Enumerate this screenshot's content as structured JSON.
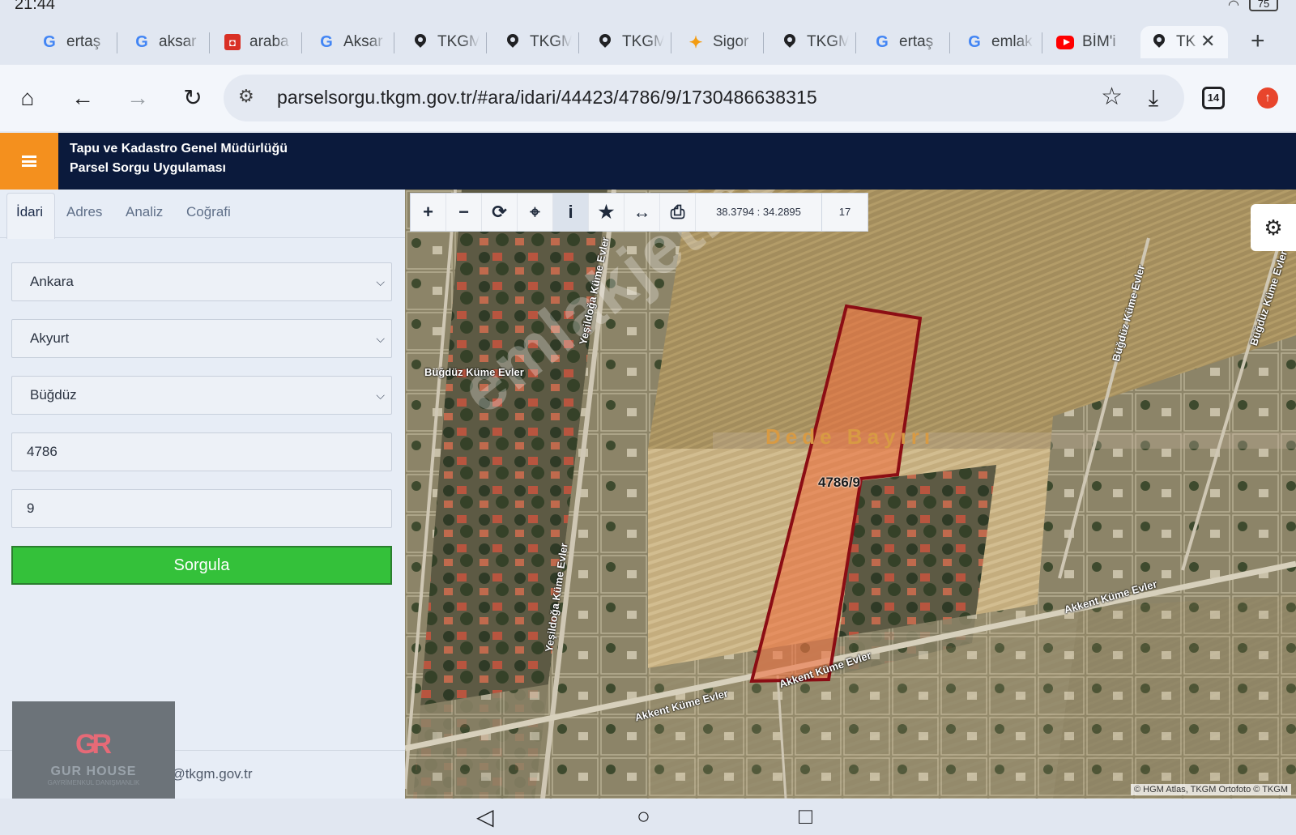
{
  "status": {
    "time": "21:44",
    "battery": "75"
  },
  "tabs": [
    {
      "icon": "google-icon",
      "label": "ertaş"
    },
    {
      "icon": "google-icon",
      "label": "aksar"
    },
    {
      "icon": "sahibinden-icon",
      "label": "araba"
    },
    {
      "icon": "google-icon",
      "label": "Aksar"
    },
    {
      "icon": "map-pin-icon",
      "label": "TKGM"
    },
    {
      "icon": "map-pin-icon",
      "label": "TKGM"
    },
    {
      "icon": "map-pin-icon",
      "label": "TKGM"
    },
    {
      "icon": "sigorta-icon",
      "label": "Sigor"
    },
    {
      "icon": "map-pin-icon",
      "label": "TKGM"
    },
    {
      "icon": "google-icon",
      "label": "ertaş"
    },
    {
      "icon": "google-icon",
      "label": "emlak"
    },
    {
      "icon": "youtube-icon",
      "label": "BİM'i"
    },
    {
      "icon": "map-pin-icon",
      "label": "TK"
    }
  ],
  "toolbar": {
    "url": "parselsorgu.tkgm.gov.tr/#ara/idari/44423/4786/9/1730486638315",
    "tab_count": "14"
  },
  "header": {
    "line1": "Tapu ve Kadastro Genel Müdürlüğü",
    "line2": "Parsel Sorgu Uygulaması"
  },
  "panel": {
    "tabs": [
      "İdari",
      "Adres",
      "Analiz",
      "Coğrafi"
    ],
    "il": "Ankara",
    "ilce": "Akyurt",
    "mahalle": "Büğdüz",
    "ada": "4786",
    "parsel": "9",
    "button": "Sorgula",
    "email": "cbs@tkgm.gov.tr"
  },
  "logo": {
    "mark": "GR",
    "name": "GUR HOUSE",
    "sub": "GAYRİMENKUL DANIŞMANLIK"
  },
  "map": {
    "coords": "38.3794 : 34.2895",
    "zoom": "17",
    "place_label": "Dede Bayırı",
    "parcel_label": "4786/9",
    "watermark": "emlakjet.com",
    "labels": {
      "bugduz1": "Büğdüz Küme Evler",
      "bugduz2": "Büğdüz Küme Evler",
      "bugduz3": "Büğdüz Küme Evler",
      "yesildoga1": "Yeşildoğa Küme Evler",
      "yesildoga2": "Yeşildoğa Küme Evler",
      "akkent1": "Akkent Küme Evler",
      "akkent2": "Akkent Küme Evler",
      "akkent3": "Akkent Küme Evler"
    },
    "attribution": "© HGM Atlas, TKGM Ortofoto © TKGM"
  },
  "colors": {
    "header": "#0b1a3c",
    "menu": "#f4901e",
    "button": "#34c13a",
    "parcel_fill": "#f26b3a",
    "parcel_stroke": "#8b0d14"
  }
}
